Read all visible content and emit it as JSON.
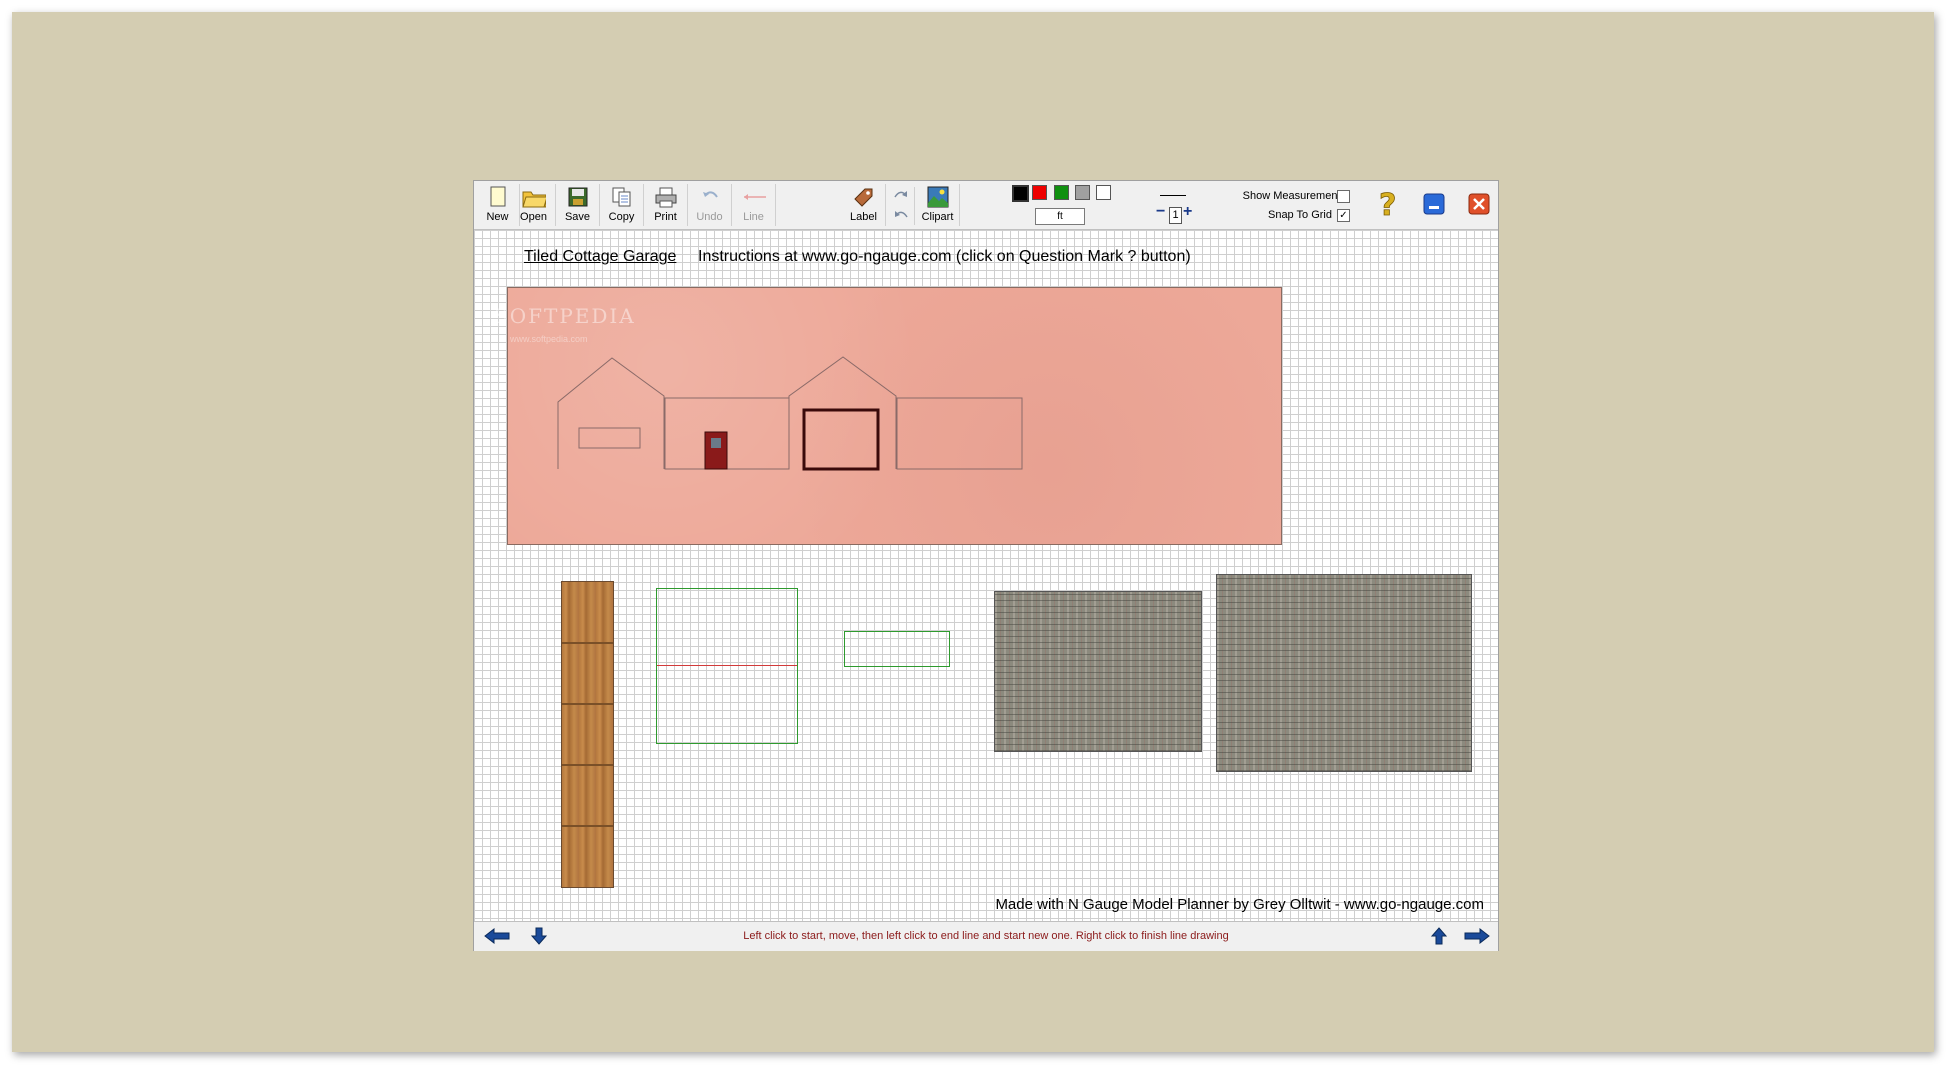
{
  "toolbar": {
    "new_label": "New",
    "open_label": "Open",
    "save_label": "Save",
    "copy_label": "Copy",
    "print_label": "Print",
    "undo_label": "Undo",
    "line_label": "Line",
    "label_label": "Label",
    "clipart_label": "Clipart",
    "unit_value": "ft",
    "zoom_value": "1",
    "show_measurements_label": "Show Measurements",
    "show_measurements_checked": false,
    "snap_to_grid_label": "Snap To Grid",
    "snap_to_grid_checked": true,
    "snap_check_glyph": "✓",
    "colors": [
      "#000000",
      "#ee0000",
      "#109010",
      "#a0a0a0",
      "#ffffff"
    ]
  },
  "canvas": {
    "title": "Tiled Cottage Garage",
    "instructions": "Instructions at www.go-ngauge.com (click on Question Mark ? button)",
    "watermark": "SOFTPEDIA",
    "watermark_sub": "www.softpedia.com",
    "footer": "Made with N Gauge Model Planner by Grey Olltwit - www.go-ngauge.com"
  },
  "statusbar": {
    "hint": "Left click to start, move, then left click to end line and start new one. Right click to finish line drawing"
  }
}
